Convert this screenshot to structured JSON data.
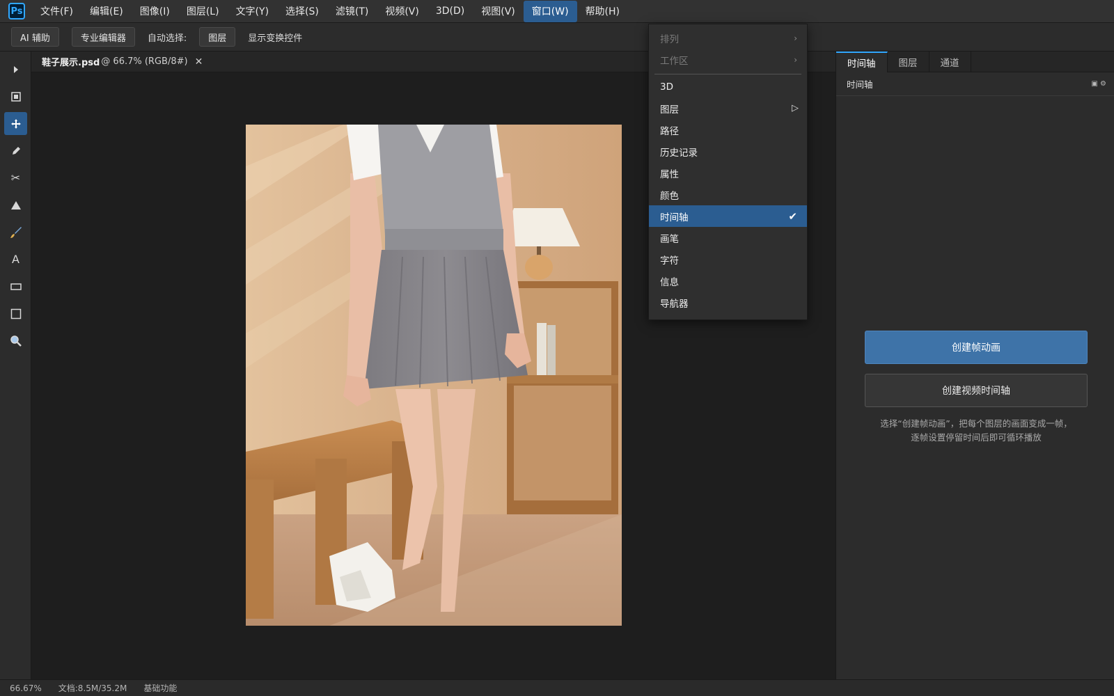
{
  "app": {
    "logo": "Ps"
  },
  "menubar": {
    "items": [
      "文件(F)",
      "编辑(E)",
      "图像(I)",
      "图层(L)",
      "文字(Y)",
      "选择(S)",
      "滤镜(T)",
      "视频(V)",
      "3D(D)",
      "视图(V)",
      "窗口(W)",
      "帮助(H)"
    ],
    "active": "窗口(W)"
  },
  "options": {
    "ai_button": "AI 辅助",
    "pro_editor_button": "专业编辑器",
    "auto_select_label": "自动选择:",
    "layer_button": "图层",
    "show_transform_label": "显示变换控件"
  },
  "toolbar": {
    "tools": [
      "move-selection-arrow-icon",
      "marquee-icon",
      "move-tool-icon",
      "pencil-icon",
      "scissors-icon",
      "triangle-shape-icon",
      "brush-icon",
      "text-icon",
      "rectangle-icon",
      "square-icon",
      "zoom-icon"
    ],
    "active_tool": "move-tool-icon"
  },
  "document": {
    "filename": "鞋子展示.psd",
    "info": "@ 66.7% (RGB/8#)",
    "close_symbol": "✕"
  },
  "window_menu": {
    "disabled_items": [
      {
        "label": "排列",
        "arrow": "›"
      },
      {
        "label": "工作区",
        "arrow": "›"
      }
    ],
    "items": [
      {
        "label": "3D"
      },
      {
        "label": "图层",
        "submenu_icon": "▷"
      },
      {
        "label": "路径"
      },
      {
        "label": "历史记录"
      },
      {
        "label": "属性"
      },
      {
        "label": "颜色"
      },
      {
        "label": "时间轴",
        "checked": true,
        "check_symbol": "✔"
      },
      {
        "label": "画笔"
      },
      {
        "label": "字符"
      },
      {
        "label": "信息"
      },
      {
        "label": "导航器"
      }
    ]
  },
  "right_panel": {
    "tabs": [
      "时间轴",
      "图层",
      "通道"
    ],
    "active_tab": "时间轴",
    "header_title": "时间轴",
    "header_icons": "▣ ⚙",
    "create_frame_button": "创建帧动画",
    "create_video_button": "创建视频时间轴",
    "hint_line1": "选择“创建帧动画”，把每个图层的画面变成一帧，",
    "hint_line2": "逐帧设置停留时间后即可循环播放"
  },
  "status": {
    "zoom": "66.67%",
    "doc": "文档:8.5M/35.2M",
    "workspace": "基础功能"
  },
  "colors": {
    "accent": "#2b5d91",
    "primary_button": "#3e73a8",
    "logo": "#31a8ff"
  }
}
